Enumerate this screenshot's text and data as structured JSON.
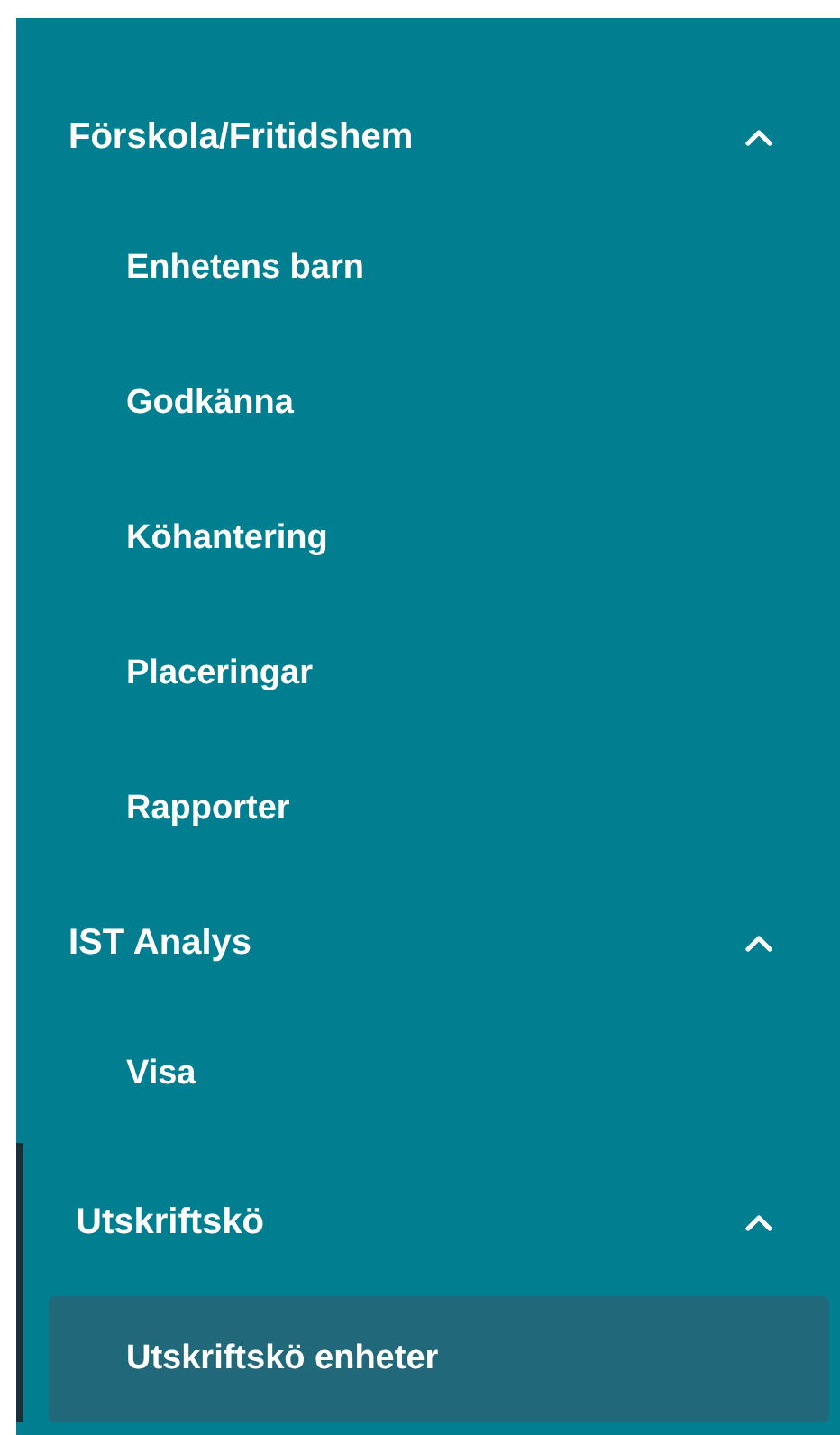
{
  "menu": [
    {
      "title": "Förskola/Fritidshem",
      "expanded": true,
      "active": false,
      "items": [
        {
          "label": "Enhetens barn",
          "selected": false
        },
        {
          "label": "Godkänna",
          "selected": false
        },
        {
          "label": "Köhantering",
          "selected": false
        },
        {
          "label": "Placeringar",
          "selected": false
        },
        {
          "label": "Rapporter",
          "selected": false
        }
      ]
    },
    {
      "title": "IST Analys",
      "expanded": true,
      "active": false,
      "items": [
        {
          "label": "Visa",
          "selected": false
        }
      ]
    },
    {
      "title": "Utskriftskö",
      "expanded": true,
      "active": true,
      "items": [
        {
          "label": "Utskriftskö enheter",
          "selected": true
        }
      ]
    }
  ]
}
